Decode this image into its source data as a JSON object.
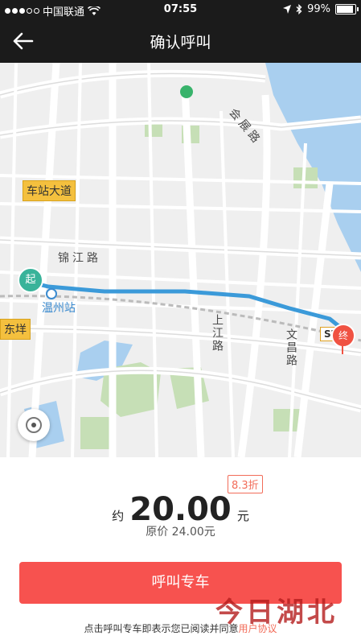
{
  "status_bar": {
    "carrier": "中国联通",
    "time": "07:55",
    "battery": "99%"
  },
  "nav": {
    "title": "确认呼叫"
  },
  "map": {
    "labels": {
      "huizhan_road": "会展路",
      "chezhan_avenue": "车站大道",
      "jinjiang_road": "锦江路",
      "wenzhou_station": "温州站",
      "dongyang": "东垟",
      "shangjiang_road": "上江路",
      "wenchang_road": "文昌路",
      "s77": "S77"
    },
    "start_marker": "起",
    "end_marker": "终",
    "colors": {
      "route": "#3b9ad9",
      "start": "#39b39a",
      "end": "#f05242",
      "water": "#a9cfef",
      "green": "#c6dfb6"
    }
  },
  "fare": {
    "prefix": "约",
    "amount": "20.00",
    "unit": "元",
    "discount": "8.3折",
    "original": "原价 24.00元"
  },
  "call_button": "呼叫专车",
  "agreement": {
    "text": "点击呼叫专车即表示您已阅读并同意",
    "link": "用户协议"
  },
  "watermark": "今日湖北"
}
